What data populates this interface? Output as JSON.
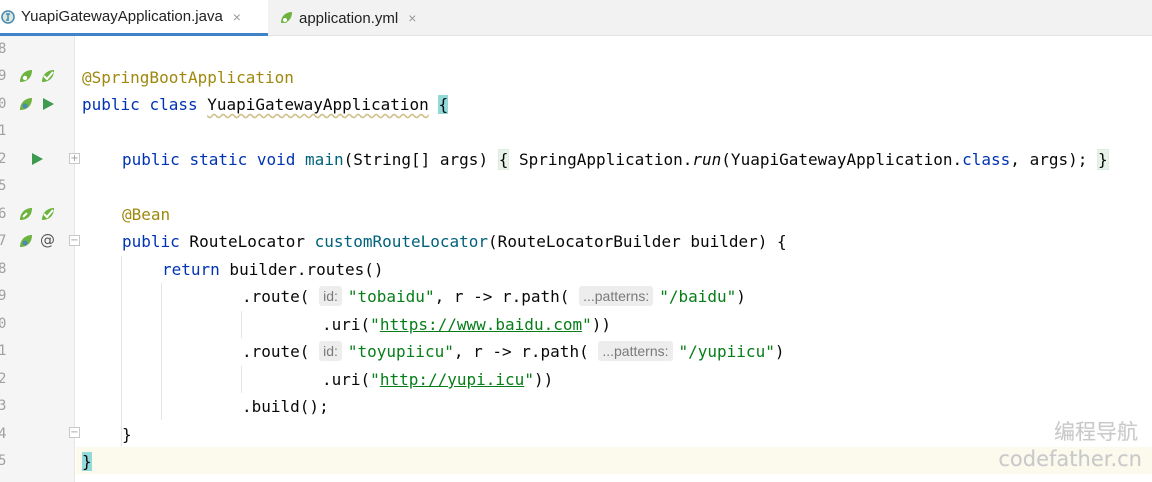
{
  "tabs": [
    {
      "label": "YuapiGatewayApplication.java",
      "close": "×",
      "active": true
    },
    {
      "label": "application.yml",
      "close": "×",
      "active": false
    }
  ],
  "gutter": {
    "line_numbers": [
      "8",
      "9",
      "0",
      "1",
      "2",
      "5",
      "6",
      "7",
      "8",
      "9",
      "0",
      "1",
      "2",
      "3",
      "4",
      "5"
    ],
    "icons": [
      "spring-bean-icon",
      "spring-run-config-icon",
      "run-icon",
      "override-icon",
      "at-sign-icon"
    ],
    "at_symbol": "@"
  },
  "code": {
    "l2_annotation": "@SpringBootApplication",
    "l3_public": "public",
    "l3_class": "class",
    "l3_name": "YuapiGatewayApplication",
    "l3_brace": "{",
    "l5_public": "public",
    "l5_static": "static",
    "l5_void": "void",
    "l5_main": "main",
    "l5_params": "(String[] args)",
    "l5_open": "{",
    "l5_body_1": " SpringApplication.",
    "l5_run": "run",
    "l5_body_2": "(YuapiGatewayApplication.",
    "l5_class_kw": "class",
    "l5_body_3": ", args); ",
    "l5_close": "}",
    "l7_annotation": "@Bean",
    "l8_public": "public",
    "l8_type": " RouteLocator ",
    "l8_method": "customRouteLocator",
    "l8_params": "(RouteLocatorBuilder builder) {",
    "l9_return": "return",
    "l9_rest": " builder.routes()",
    "l10_route": ".route(",
    "l10_hint_id": "id:",
    "l10_id": "\"tobaidu\"",
    "l10_lambda": ", r -> r.path(",
    "l10_hint_patterns": "...patterns:",
    "l10_path": "\"/baidu\"",
    "l10_end": ")",
    "l11_uri": ".uri(",
    "l11_q1": "\"",
    "l11_url": "https://www.baidu.com",
    "l11_q2": "\"",
    "l11_end": "))",
    "l12_route": ".route(",
    "l12_hint_id": "id:",
    "l12_id": "\"toyupiicu\"",
    "l12_lambda": ", r -> r.path(",
    "l12_hint_patterns": "...patterns:",
    "l12_path": "\"/yupiicu\"",
    "l12_end": ")",
    "l13_uri": ".uri(",
    "l13_q1": "\"",
    "l13_url": "http://yupi.icu",
    "l13_q2": "\"",
    "l13_end": "))",
    "l14_build": ".build();",
    "l15_close": "}",
    "l16_close": "}"
  },
  "watermark": {
    "line1": "编程导航",
    "line2": "codefather.cn"
  }
}
